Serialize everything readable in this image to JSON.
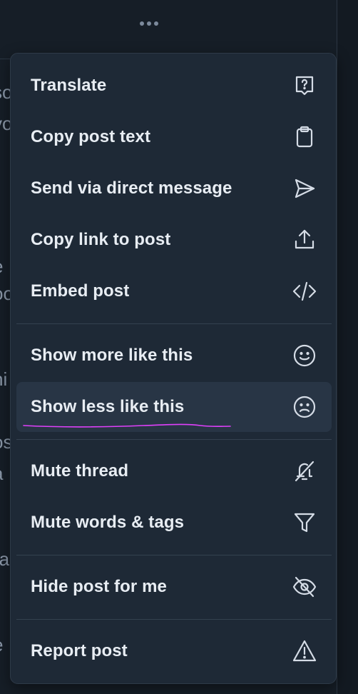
{
  "background": {
    "fragments": [
      "so",
      "yo",
      "e",
      "oo",
      "ni",
      "os",
      "a",
      "ra",
      "e"
    ]
  },
  "menu": {
    "items": [
      {
        "id": "translate",
        "label": "Translate",
        "icon": "translate-icon"
      },
      {
        "id": "copy-post-text",
        "label": "Copy post text",
        "icon": "clipboard-icon"
      },
      {
        "id": "send-via-direct-message",
        "label": "Send via direct message",
        "icon": "send-icon"
      },
      {
        "id": "copy-link-to-post",
        "label": "Copy link to post",
        "icon": "share-icon"
      },
      {
        "id": "embed-post",
        "label": "Embed post",
        "icon": "code-icon"
      },
      {
        "id": "show-more-like-this",
        "label": "Show more like this",
        "icon": "smile-icon"
      },
      {
        "id": "show-less-like-this",
        "label": "Show less like this",
        "icon": "frown-icon",
        "highlighted": true
      },
      {
        "id": "mute-thread",
        "label": "Mute thread",
        "icon": "bell-off-icon"
      },
      {
        "id": "mute-words-tags",
        "label": "Mute words & tags",
        "icon": "filter-icon"
      },
      {
        "id": "hide-post-for-me",
        "label": "Hide post for me",
        "icon": "eye-off-icon"
      },
      {
        "id": "report-post",
        "label": "Report post",
        "icon": "warning-icon"
      }
    ]
  },
  "colors": {
    "menu_bg": "#1e2936",
    "highlight_bg": "#283545",
    "annotation": "#e040fb"
  }
}
